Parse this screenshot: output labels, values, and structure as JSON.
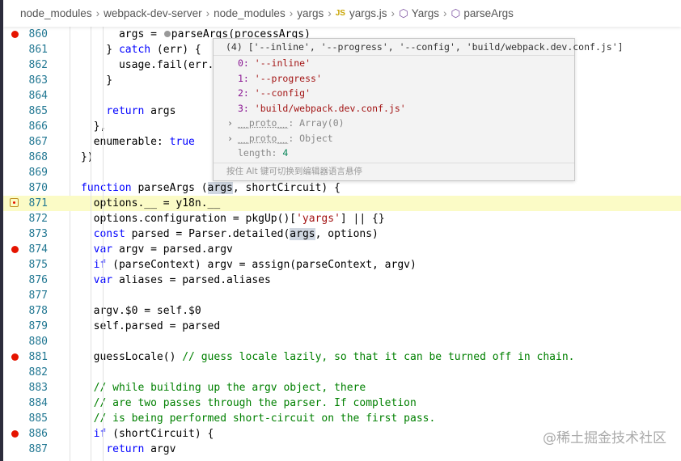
{
  "breadcrumb": [
    "node_modules",
    "webpack-dev-server",
    "node_modules",
    "yargs",
    "yargs.js",
    "Yargs",
    "parseArgs"
  ],
  "breadcrumb_icons": {
    "file": "JS",
    "symbol": "cube-icon"
  },
  "lines": [
    {
      "n": "860",
      "bp": true,
      "tokens": [
        [
          "      args = ",
          ""
        ],
        [
          "",
          "inline-bp"
        ],
        [
          "parseArgs(processArgs)",
          ""
        ]
      ]
    },
    {
      "n": "861",
      "tokens": [
        [
          "    } ",
          ""
        ],
        [
          "catch",
          "kw"
        ],
        [
          " (err) {",
          ""
        ]
      ]
    },
    {
      "n": "862",
      "tokens": [
        [
          "      usage.fail(err.message)",
          ""
        ]
      ]
    },
    {
      "n": "863",
      "tokens": [
        [
          "    }",
          ""
        ]
      ]
    },
    {
      "n": "864",
      "tokens": []
    },
    {
      "n": "865",
      "tokens": [
        [
          "    ",
          ""
        ],
        [
          "return",
          "kw"
        ],
        [
          " args",
          ""
        ]
      ]
    },
    {
      "n": "866",
      "tokens": [
        [
          "  },",
          ""
        ]
      ]
    },
    {
      "n": "867",
      "tokens": [
        [
          "  enumerable: ",
          ""
        ],
        [
          "true",
          "kw"
        ]
      ]
    },
    {
      "n": "868",
      "tokens": [
        [
          "})",
          ""
        ]
      ]
    },
    {
      "n": "869",
      "tokens": []
    },
    {
      "n": "870",
      "tokens": [
        [
          "function",
          "kw"
        ],
        [
          " parseArgs (",
          ""
        ],
        [
          "args",
          "hl"
        ],
        [
          ", shortCircuit) {",
          ""
        ]
      ]
    },
    {
      "n": "871",
      "current": true,
      "tokens": [
        [
          "  options.__ = y18n.__",
          ""
        ]
      ]
    },
    {
      "n": "872",
      "tokens": [
        [
          "  options.configuration = pkgUp()[",
          ""
        ],
        [
          "'yargs'",
          "str"
        ],
        [
          "] || {}",
          ""
        ]
      ]
    },
    {
      "n": "873",
      "tokens": [
        [
          "  ",
          ""
        ],
        [
          "const",
          "kw"
        ],
        [
          " parsed = Parser.detailed(",
          ""
        ],
        [
          "args",
          "hl"
        ],
        [
          ", options)",
          ""
        ]
      ]
    },
    {
      "n": "874",
      "bp": true,
      "tokens": [
        [
          "  ",
          ""
        ],
        [
          "var",
          "kw"
        ],
        [
          " argv = parsed.argv",
          ""
        ]
      ]
    },
    {
      "n": "875",
      "tokens": [
        [
          "  ",
          ""
        ],
        [
          "if",
          "kw"
        ],
        [
          " (parseContext) argv = assign(parseContext, argv)",
          ""
        ]
      ]
    },
    {
      "n": "876",
      "tokens": [
        [
          "  ",
          ""
        ],
        [
          "var",
          "kw"
        ],
        [
          " aliases = parsed.aliases",
          ""
        ]
      ]
    },
    {
      "n": "877",
      "tokens": []
    },
    {
      "n": "878",
      "tokens": [
        [
          "  argv.$0 = self.$0",
          ""
        ]
      ]
    },
    {
      "n": "879",
      "tokens": [
        [
          "  self.parsed = parsed",
          ""
        ]
      ]
    },
    {
      "n": "880",
      "tokens": []
    },
    {
      "n": "881",
      "bp": true,
      "tokens": [
        [
          "  guessLocale() ",
          ""
        ],
        [
          "// guess locale lazily, so that it can be turned off in chain.",
          "cm"
        ]
      ]
    },
    {
      "n": "882",
      "tokens": []
    },
    {
      "n": "883",
      "tokens": [
        [
          "  ",
          ""
        ],
        [
          "// while building up the argv object, there",
          "cm"
        ]
      ]
    },
    {
      "n": "884",
      "tokens": [
        [
          "  ",
          ""
        ],
        [
          "// are two passes through the parser. If completion",
          "cm"
        ]
      ]
    },
    {
      "n": "885",
      "tokens": [
        [
          "  ",
          ""
        ],
        [
          "// is being performed short-circuit on the first pass.",
          "cm"
        ]
      ]
    },
    {
      "n": "886",
      "bp": true,
      "tokens": [
        [
          "  ",
          ""
        ],
        [
          "if",
          "kw"
        ],
        [
          " (shortCircuit) {",
          ""
        ]
      ]
    },
    {
      "n": "887",
      "tokens": [
        [
          "    ",
          ""
        ],
        [
          "return",
          "kw"
        ],
        [
          " argv",
          ""
        ]
      ]
    }
  ],
  "hover": {
    "header": "(4) ['--inline', '--progress', '--config', 'build/webpack.dev.conf.js']",
    "items": [
      {
        "key": "0",
        "value": "'--inline'"
      },
      {
        "key": "1",
        "value": "'--progress'"
      },
      {
        "key": "2",
        "value": "'--config'"
      },
      {
        "key": "3",
        "value": "'build/webpack.dev.conf.js'"
      }
    ],
    "protos": [
      {
        "key": "__proto__",
        "value": "Array(0)"
      },
      {
        "key": "__proto__",
        "value": "Object"
      }
    ],
    "length_key": "length",
    "length_value": "4",
    "footer": "按住 Alt 键可切换到编辑器语言悬停"
  },
  "watermark": "@稀土掘金技术社区"
}
